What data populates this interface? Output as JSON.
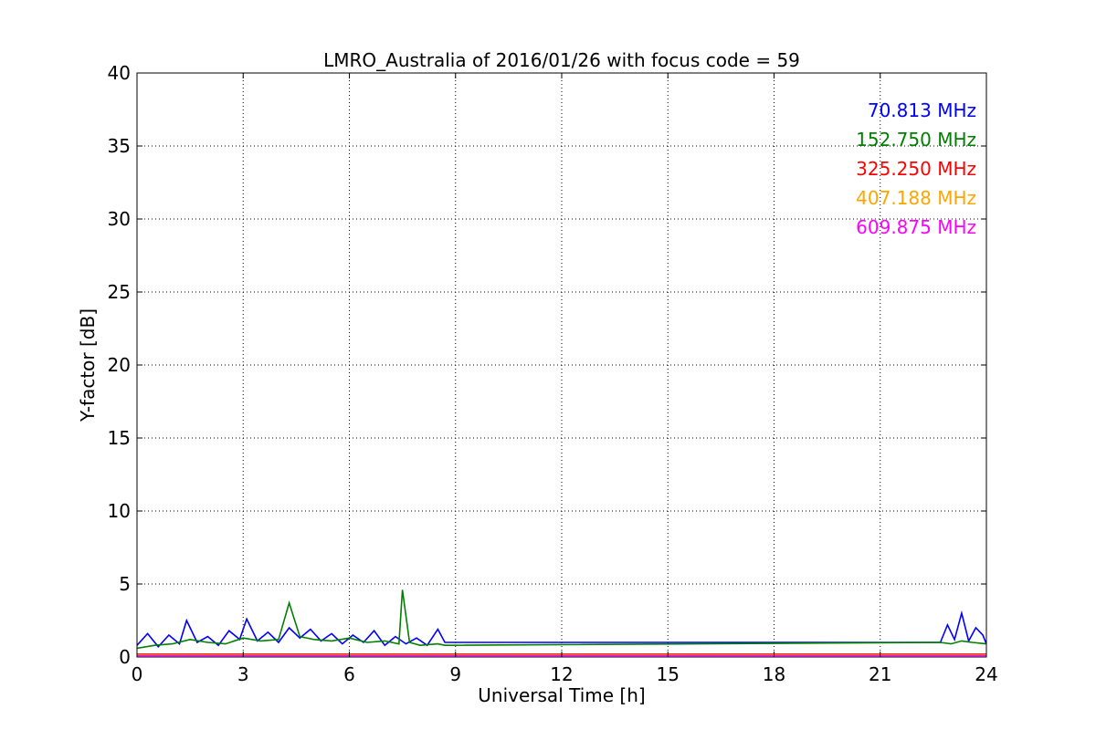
{
  "chart_data": {
    "type": "line",
    "title": "LMRO_Australia of 2016/01/26 with focus code = 59",
    "xlabel": "Universal Time [h]",
    "ylabel": "Y-factor [dB]",
    "xlim": [
      0,
      24
    ],
    "ylim": [
      0,
      40
    ],
    "xticks": [
      0,
      3,
      6,
      9,
      12,
      15,
      18,
      21,
      24
    ],
    "yticks": [
      0,
      5,
      10,
      15,
      20,
      25,
      30,
      35,
      40
    ],
    "grid": true,
    "legend_position": "top-right",
    "series": [
      {
        "name": "70.813 MHz",
        "color": "#0000ff",
        "x": [
          0,
          0.3,
          0.6,
          0.9,
          1.2,
          1.4,
          1.7,
          2.0,
          2.3,
          2.6,
          2.9,
          3.1,
          3.4,
          3.7,
          4.0,
          4.3,
          4.6,
          4.9,
          5.2,
          5.5,
          5.8,
          6.1,
          6.4,
          6.7,
          7.0,
          7.3,
          7.6,
          7.9,
          8.2,
          8.5,
          8.7,
          22.7,
          22.9,
          23.1,
          23.3,
          23.5,
          23.7,
          23.9,
          24.0
        ],
        "y": [
          0.8,
          1.6,
          0.7,
          1.5,
          0.9,
          2.5,
          1.0,
          1.4,
          0.8,
          1.8,
          1.2,
          2.6,
          1.1,
          1.7,
          1.0,
          2.0,
          1.3,
          1.9,
          1.1,
          1.6,
          0.9,
          1.5,
          1.0,
          1.8,
          0.8,
          1.4,
          0.9,
          1.3,
          0.8,
          1.9,
          1.0,
          1.0,
          2.2,
          1.2,
          3.0,
          1.1,
          2.0,
          1.5,
          0.9
        ]
      },
      {
        "name": "152.750 MHz",
        "color": "#008000",
        "x": [
          0,
          0.5,
          1.0,
          1.5,
          2.0,
          2.5,
          3.0,
          3.5,
          4.0,
          4.3,
          4.6,
          5.0,
          5.5,
          6.0,
          6.5,
          7.0,
          7.4,
          7.5,
          7.7,
          8.0,
          8.5,
          8.7,
          22.7,
          23.0,
          23.3,
          23.6,
          24.0
        ],
        "y": [
          0.6,
          0.8,
          0.9,
          1.2,
          1.0,
          0.9,
          1.3,
          1.1,
          1.2,
          3.7,
          1.4,
          1.2,
          1.1,
          1.3,
          1.0,
          1.1,
          0.9,
          4.6,
          1.0,
          0.8,
          0.9,
          0.8,
          1.0,
          0.9,
          1.1,
          1.0,
          0.9
        ]
      },
      {
        "name": "325.250 MHz",
        "color": "#ff0000",
        "x": [
          0,
          24
        ],
        "y": [
          0.2,
          0.2
        ]
      },
      {
        "name": "407.188 MHz",
        "color": "#ffa500",
        "x": [
          0,
          24
        ],
        "y": [
          0.15,
          0.15
        ]
      },
      {
        "name": "609.875 MHz",
        "color": "#ff00ff",
        "x": [
          0,
          24
        ],
        "y": [
          0.1,
          0.1
        ]
      }
    ]
  }
}
